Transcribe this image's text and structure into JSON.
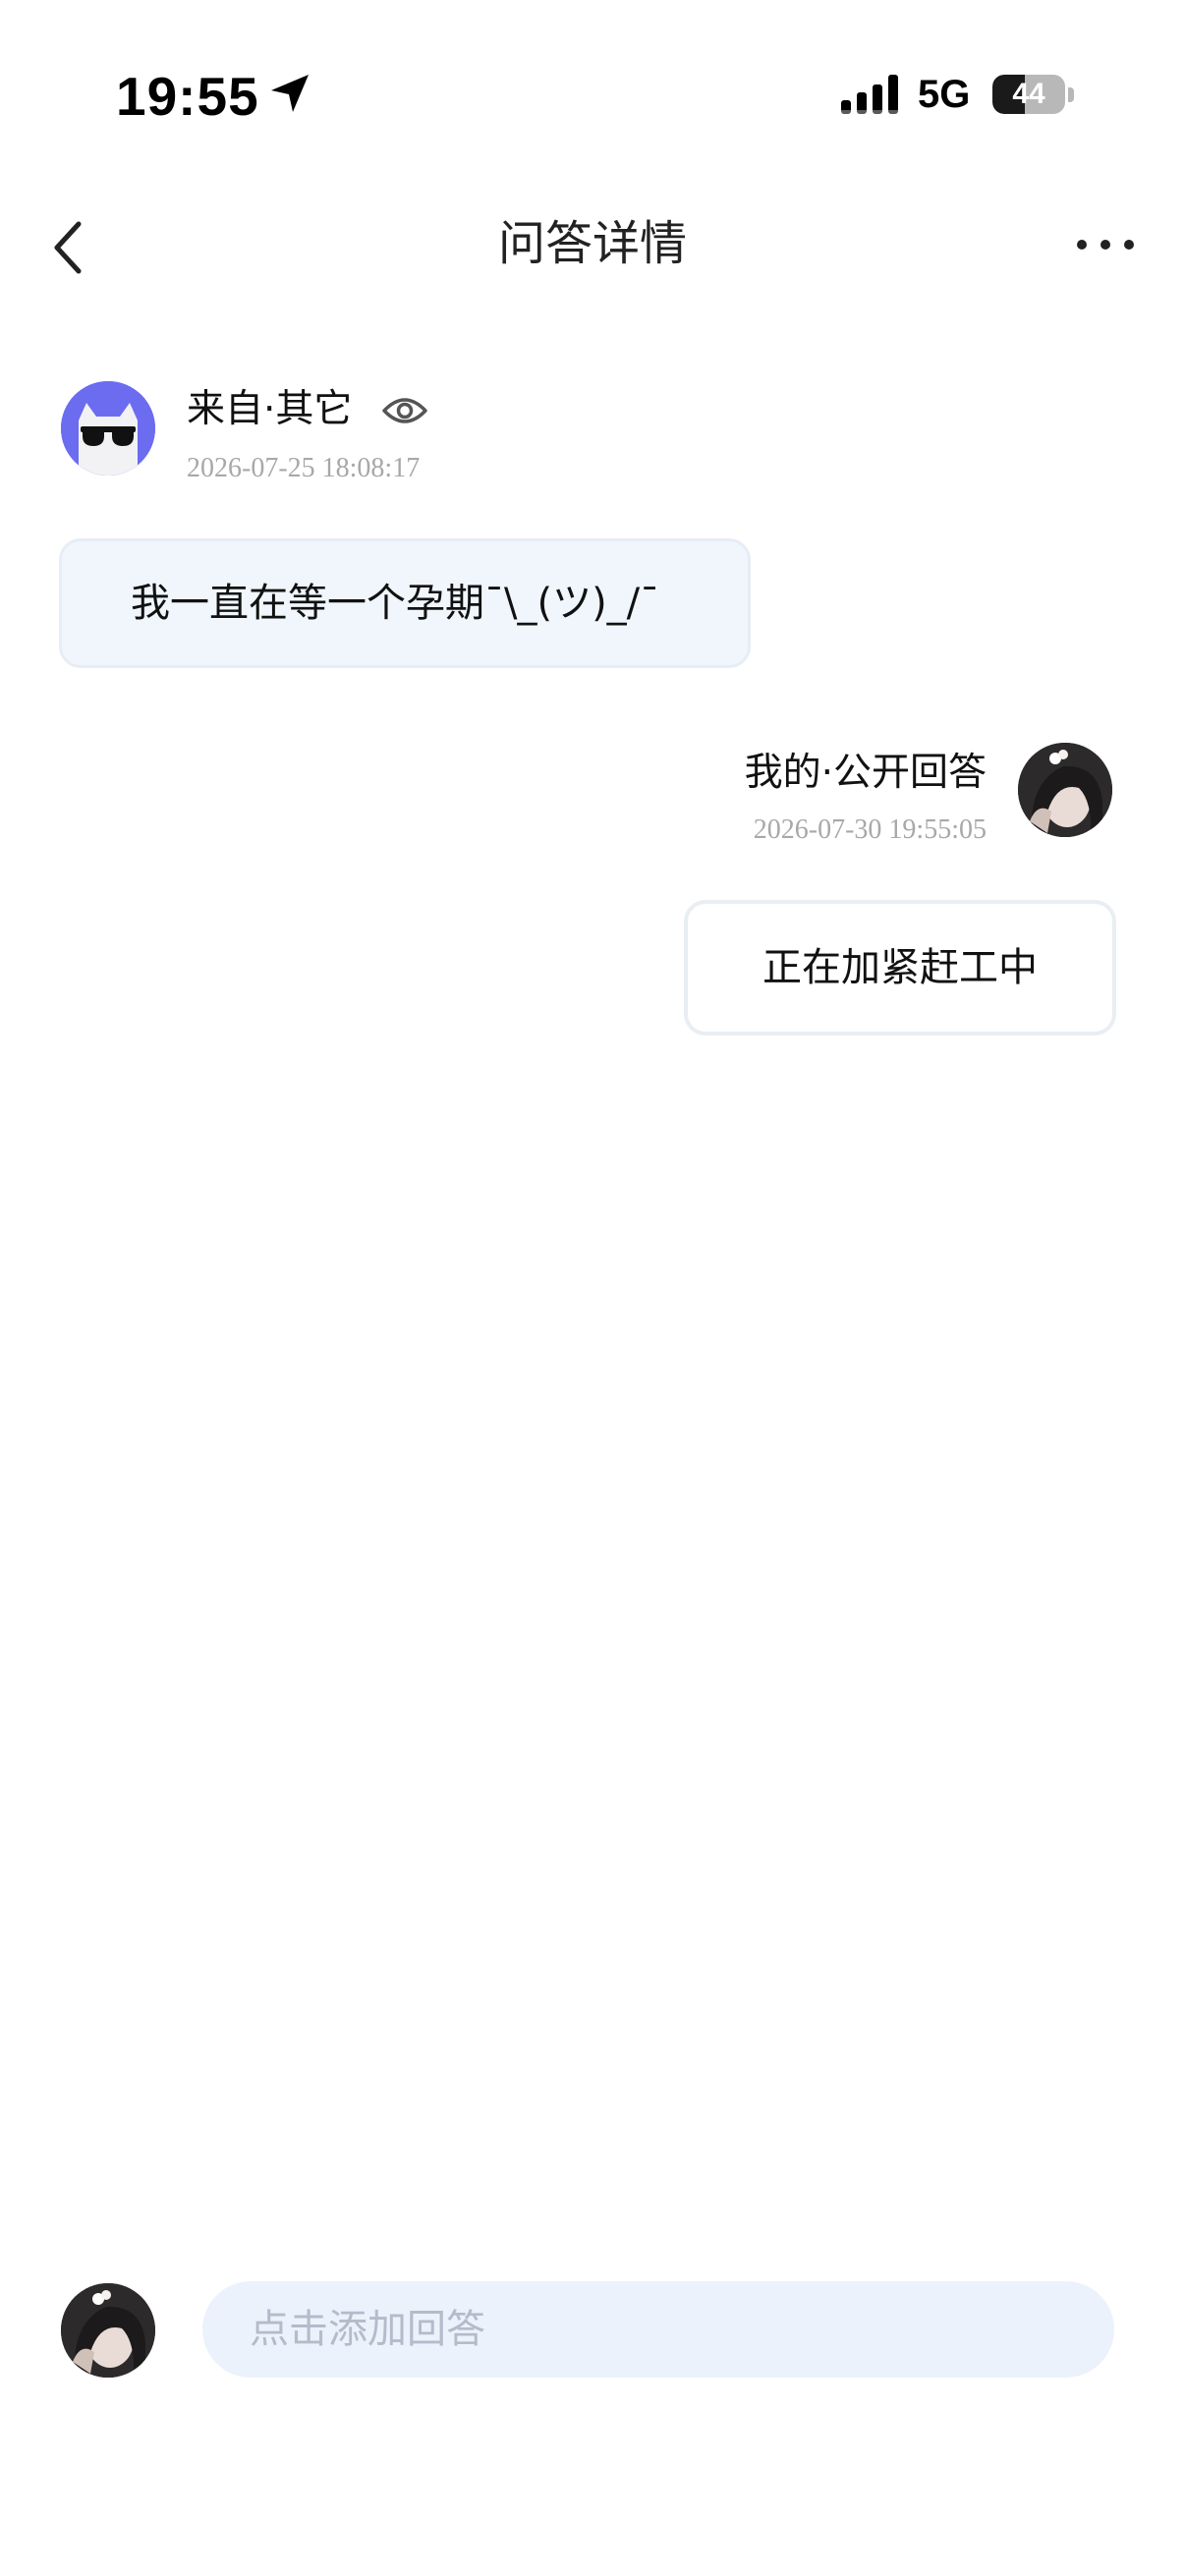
{
  "status_bar": {
    "time": "19:55",
    "network": "5G",
    "battery_level": "44",
    "battery_fraction": 0.44
  },
  "header": {
    "title": "问答详情",
    "back_icon": "chevron-left-icon",
    "more_icon": "more-horizontal-icon"
  },
  "question": {
    "source_label": "来自·其它",
    "visibility_icon": "eye-icon",
    "timestamp": "2026-07-25 18:08:17",
    "text": "我一直在等一个孕期¯\\_(ツ)_/¯",
    "avatar_icon": "cat-sunglasses-avatar",
    "avatar_color": "#6b6cf0",
    "bubble_color": "#f1f6fd"
  },
  "answer": {
    "author_label": "我的·公开回答",
    "timestamp": "2026-07-30 19:55:05",
    "text": "正在加紧赶工中",
    "avatar_icon": "user-photo-avatar"
  },
  "compose": {
    "placeholder": "点击添加回答",
    "avatar_icon": "user-photo-avatar"
  },
  "colors": {
    "timestamp": "#a8a8a8",
    "input_background": "#ecf2fb",
    "input_placeholder": "#b3bccb"
  }
}
